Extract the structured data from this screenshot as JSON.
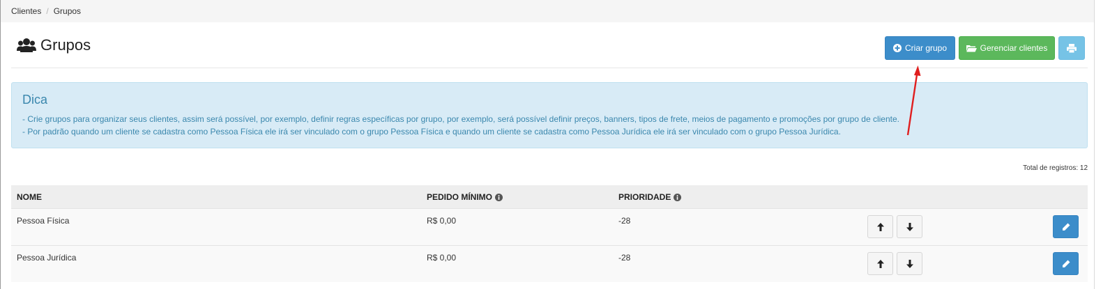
{
  "breadcrumb": {
    "items": [
      "Clientes",
      "Grupos"
    ],
    "separator": "/"
  },
  "page": {
    "title": "Grupos",
    "title_icon": "users-icon"
  },
  "toolbar": {
    "create_label": "Criar grupo",
    "create_icon": "plus-circle-icon",
    "manage_label": "Gerenciar clientes",
    "manage_icon": "folder-open-icon",
    "print_icon": "print-icon"
  },
  "tip": {
    "title": "Dica",
    "lines": [
      "- Crie grupos para organizar seus clientes, assim será possível, por exemplo, definir regras específicas por grupo, por exemplo, será possível definir preços, banners, tipos de frete, meios de pagamento e promoções por grupo de cliente.",
      "- Por padrão quando um cliente se cadastra como Pessoa Física ele irá ser vinculado com o grupo Pessoa Física e quando um cliente se cadastra como Pessoa Jurídica ele irá ser vinculado com o grupo Pessoa Jurídica."
    ]
  },
  "table": {
    "total_label": "Total de registros: 12",
    "columns": {
      "name": "NOME",
      "min_order": "PEDIDO MÍNIMO",
      "priority": "PRIORIDADE"
    },
    "rows": [
      {
        "name": "Pessoa Física",
        "min_order": "R$ 0,00",
        "priority": "-28"
      },
      {
        "name": "Pessoa Jurídica",
        "min_order": "R$ 0,00",
        "priority": "-28"
      }
    ]
  },
  "colors": {
    "primary": "#3c8dca",
    "success": "#5cb85c",
    "info": "#76c3e6",
    "alert_bg": "#d8ebf6",
    "alert_text": "#3a87ad",
    "annotation_arrow": "#e01e1e"
  }
}
